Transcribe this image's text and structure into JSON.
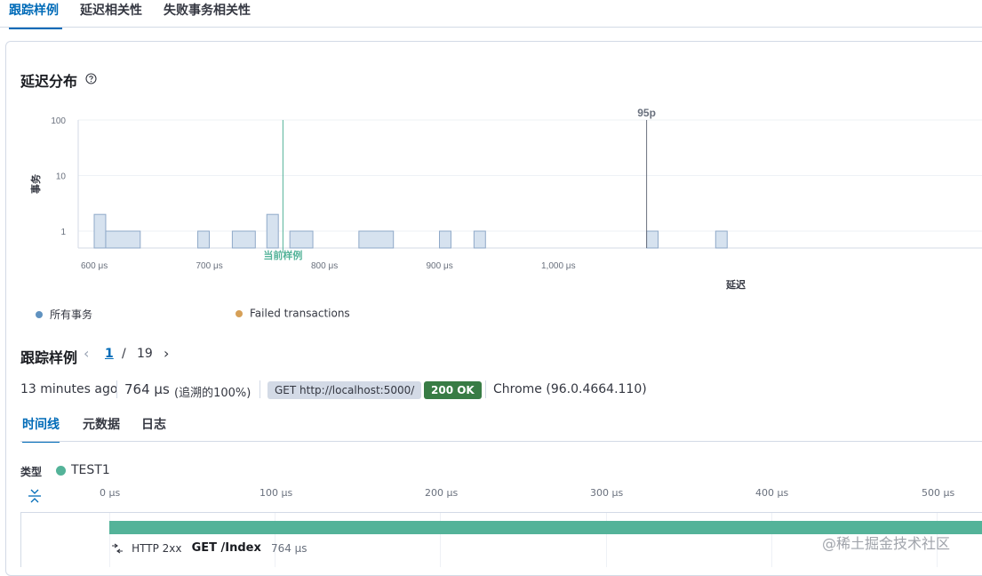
{
  "tabs": [
    "跟踪样例",
    "延迟相关性",
    "失败事务相关性"
  ],
  "distribution": {
    "title": "延迟分布",
    "help_icon": "question-circle-icon",
    "y_label": "事务",
    "x_label": "延迟",
    "current_sample_label": "当前样例",
    "percentile_label": "95p",
    "legend": [
      {
        "label": "所有事务",
        "color": "#6092c0"
      },
      {
        "label": "Failed transactions",
        "color": "#d6bf57"
      }
    ]
  },
  "chart_data": {
    "type": "bar",
    "xlabel": "延迟",
    "ylabel": "事务",
    "yscale": "log",
    "ylim": [
      0.5,
      100
    ],
    "y_ticks": [
      "100",
      "10",
      "1"
    ],
    "x_ticks": [
      "600 μs",
      "700 μs",
      "800 μs",
      "900 μs",
      "1,000 μs"
    ],
    "xlim": [
      600,
      1200
    ],
    "bars": [
      {
        "x0": 600,
        "x1": 610,
        "count": 2
      },
      {
        "x0": 610,
        "x1": 640,
        "count": 1
      },
      {
        "x0": 690,
        "x1": 700,
        "count": 1
      },
      {
        "x0": 720,
        "x1": 740,
        "count": 1
      },
      {
        "x0": 750,
        "x1": 760,
        "count": 2
      },
      {
        "x0": 770,
        "x1": 790,
        "count": 1
      },
      {
        "x0": 830,
        "x1": 860,
        "count": 1
      },
      {
        "x0": 900,
        "x1": 910,
        "count": 1
      },
      {
        "x0": 930,
        "x1": 940,
        "count": 1
      },
      {
        "x0": 1080,
        "x1": 1090,
        "count": 1
      },
      {
        "x0": 1140,
        "x1": 1150,
        "count": 1
      }
    ],
    "markers": [
      {
        "label": "当前样例",
        "x": 764
      },
      {
        "label": "95p",
        "x": 1080
      }
    ],
    "series": [
      {
        "name": "所有事务"
      },
      {
        "name": "Failed transactions"
      }
    ]
  },
  "samples": {
    "title": "跟踪样例",
    "current_page": "1",
    "separator": "/",
    "total_pages": "19",
    "time_ago": "13 minutes ago",
    "duration": "764 μs",
    "trace_percent": "(追溯的100%)",
    "request": "GET http://localhost:5000/",
    "status": "200 OK",
    "user_agent": "Chrome (96.0.4664.110)"
  },
  "subtabs": [
    "时间线",
    "元数据",
    "日志"
  ],
  "timeline": {
    "type_label": "类型",
    "service_name": "TEST1",
    "service_color": "#54b399",
    "ticks": [
      "0 μs",
      "100 μs",
      "200 μs",
      "300 μs",
      "400 μs",
      "500 μs"
    ],
    "span": {
      "http_status": "HTTP 2xx",
      "name": "GET /Index",
      "duration": "764 μs"
    }
  },
  "watermark": "@稀土掘金技术社区"
}
